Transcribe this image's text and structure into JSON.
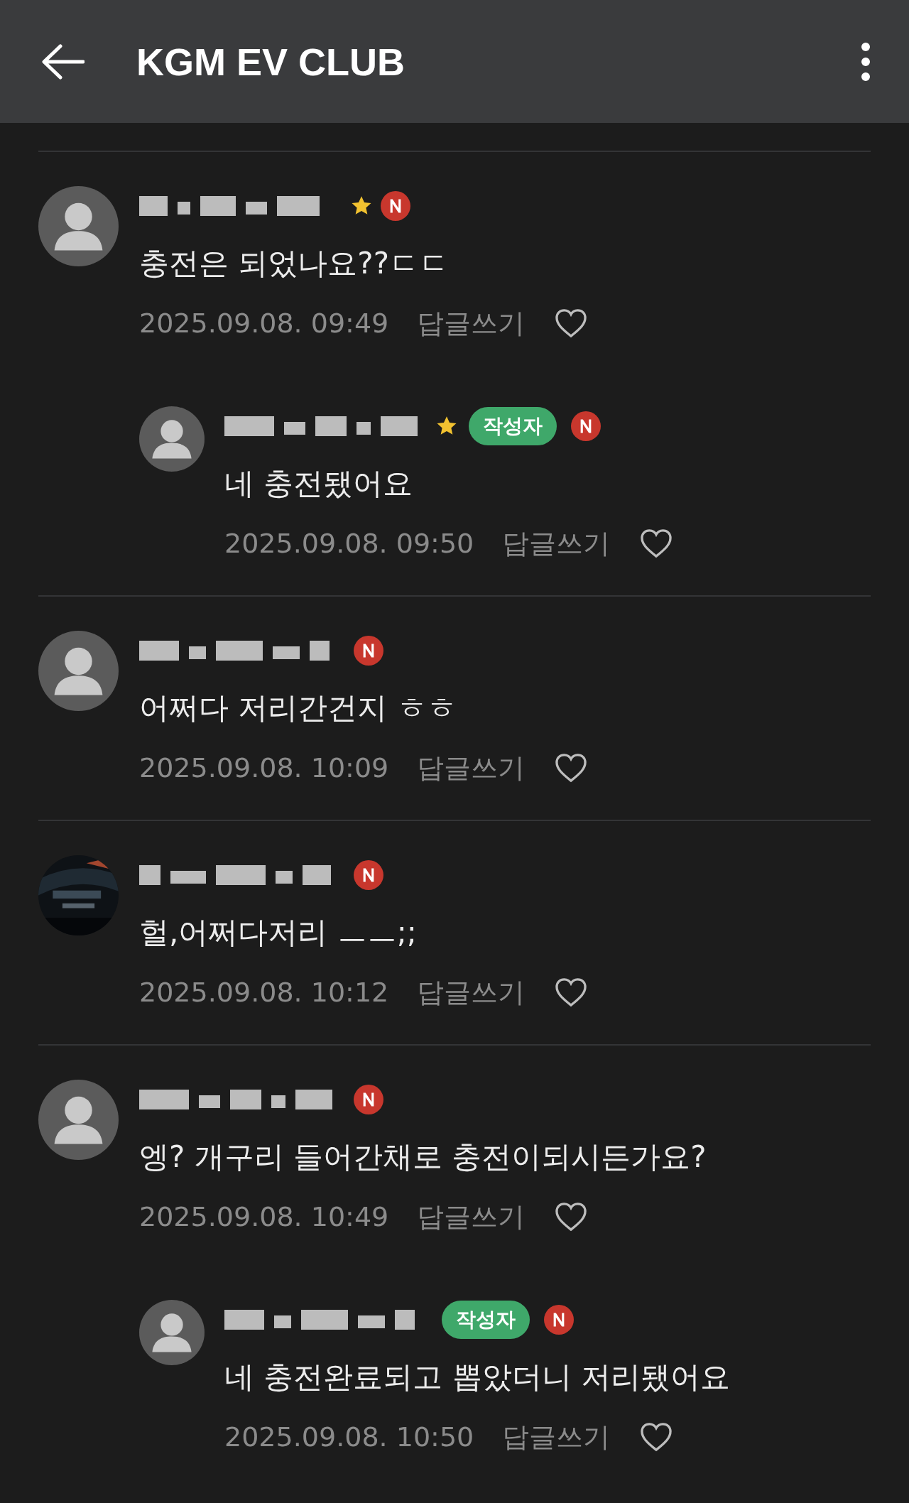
{
  "header": {
    "title": "KGM EV CLUB"
  },
  "comments": [
    {
      "avatar": {
        "kind": "default"
      },
      "star": true,
      "author": false,
      "new": true,
      "content": "충전은 되었나요??ㄷㄷ",
      "date": "2025.09.08. 09:49",
      "reply_label": "답글쓰기",
      "liked": false,
      "replies": [
        {
          "avatar": {
            "kind": "default"
          },
          "star": true,
          "author": true,
          "author_label": "작성자",
          "new": true,
          "content": "네 충전됐어요",
          "date": "2025.09.08. 09:50",
          "reply_label": "답글쓰기",
          "liked": false
        }
      ]
    },
    {
      "avatar": {
        "kind": "default"
      },
      "star": false,
      "author": false,
      "new": true,
      "content": "어쩌다 저리간건지 ㅎㅎ",
      "date": "2025.09.08. 10:09",
      "reply_label": "답글쓰기",
      "liked": false
    },
    {
      "star": false,
      "author": false,
      "new": true,
      "content": "헐,어쩌다저리 ㅡㅡ;;",
      "date": "2025.09.08. 10:12",
      "reply_label": "답글쓰기",
      "liked": false
    },
    {
      "avatar": {
        "kind": "default"
      },
      "star": false,
      "author": false,
      "new": true,
      "content": "엥? 개구리 들어간채로 충전이되시든가요?",
      "date": "2025.09.08. 10:49",
      "reply_label": "답글쓰기",
      "liked": false,
      "replies": [
        {
          "avatar": {
            "kind": "default"
          },
          "star": false,
          "author": true,
          "author_label": "작성자",
          "new": true,
          "content": "네 충전완료되고 뽑았더니 저리됐어요",
          "date": "2025.09.08. 10:50",
          "reply_label": "답글쓰기",
          "liked": false
        }
      ]
    }
  ]
}
